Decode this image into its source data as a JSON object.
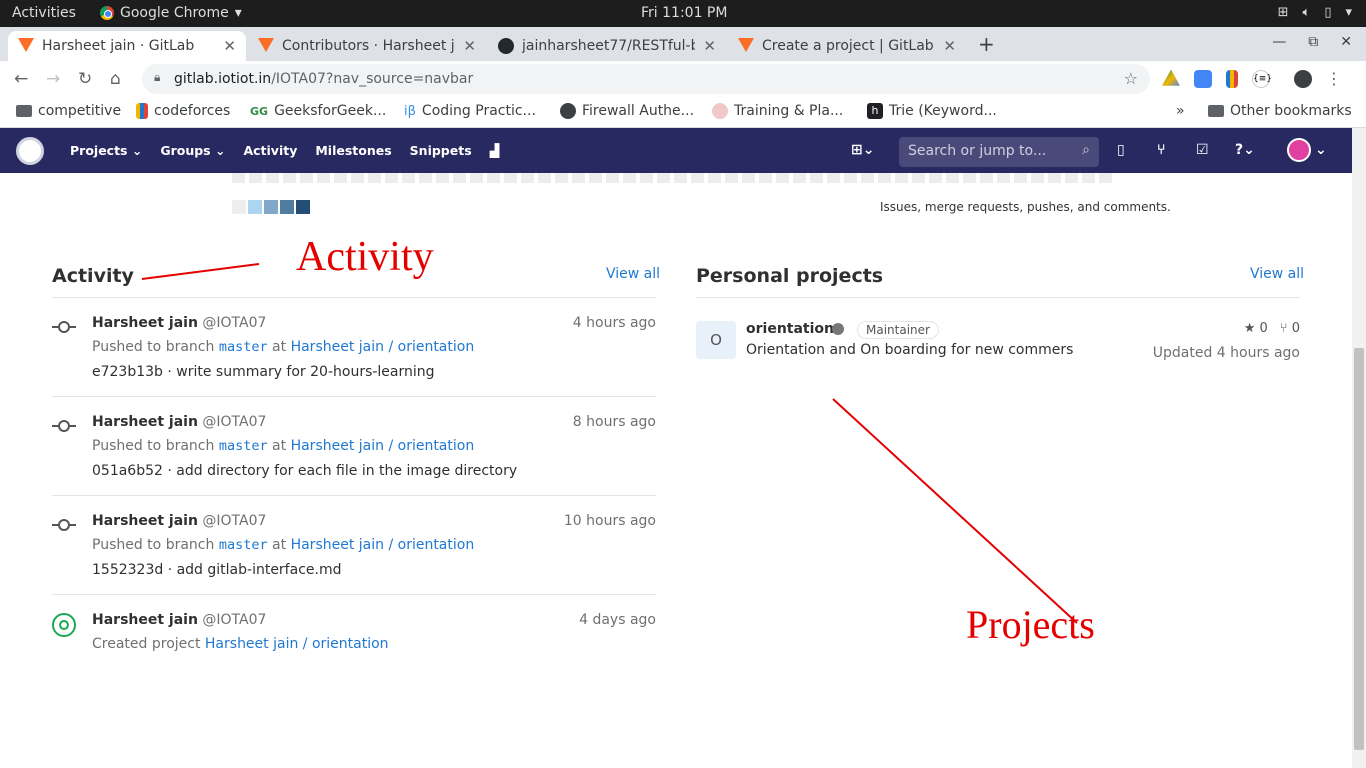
{
  "system_bar": {
    "activities": "Activities",
    "app_name": "Google Chrome",
    "clock": "Fri 11:01 PM"
  },
  "browser": {
    "tabs": [
      {
        "title": "Harsheet jain · GitLab",
        "active": true,
        "icon": "gitlab-icon"
      },
      {
        "title": "Contributors · Harsheet ja",
        "active": false,
        "icon": "gitlab-icon"
      },
      {
        "title": "jainharsheet77/RESTful-b",
        "active": false,
        "icon": "github-icon"
      },
      {
        "title": "Create a project | GitLab",
        "active": false,
        "icon": "gitlab-icon"
      }
    ],
    "new_tab": "+",
    "url_host": "gitlab.iotiot.in",
    "url_path": "/IOTA07?nav_source=navbar",
    "bookmarks": [
      {
        "label": "competitive",
        "icon": "folder-icon"
      },
      {
        "label": "codeforces",
        "icon": "codeforces-icon"
      },
      {
        "label": "GeeksforGeek...",
        "icon": "gfg-icon"
      },
      {
        "label": "Coding Practic...",
        "icon": "interviewbit-icon"
      },
      {
        "label": "Firewall Authe...",
        "icon": "globe-icon"
      },
      {
        "label": "Training & Pla...",
        "icon": "seal-icon"
      },
      {
        "label": "Trie (Keyword...",
        "icon": "h-icon"
      }
    ],
    "bookmarks_more": "»",
    "other_bookmarks": "Other bookmarks"
  },
  "gitlab_nav": {
    "items": [
      "Projects ⌄",
      "Groups ⌄",
      "Activity",
      "Milestones",
      "Snippets"
    ],
    "search_placeholder": "Search or jump to..."
  },
  "calendar": {
    "caption": "Issues, merge requests, pushes, and comments.",
    "legend_colors": [
      "#ededed",
      "#acd5f2",
      "#7fa8c9",
      "#527ba0",
      "#254e77"
    ]
  },
  "activity": {
    "title": "Activity",
    "view_all": "View all",
    "events": [
      {
        "author": "Harsheet jain",
        "handle": "@IOTA07",
        "time": "4 hours ago",
        "action": "Pushed to branch",
        "branch": "master",
        "at": "at",
        "project": "Harsheet jain / orientation",
        "commit": "e723b13b · write summary for 20-hours-learning",
        "type": "push"
      },
      {
        "author": "Harsheet jain",
        "handle": "@IOTA07",
        "time": "8 hours ago",
        "action": "Pushed to branch",
        "branch": "master",
        "at": "at",
        "project": "Harsheet jain / orientation",
        "commit": "051a6b52 · add directory for each file in the image directory",
        "type": "push"
      },
      {
        "author": "Harsheet jain",
        "handle": "@IOTA07",
        "time": "10 hours ago",
        "action": "Pushed to branch",
        "branch": "master",
        "at": "at",
        "project": "Harsheet jain / orientation",
        "commit": "1552323d · add gitlab-interface.md",
        "type": "push"
      },
      {
        "author": "Harsheet jain",
        "handle": "@IOTA07",
        "time": "4 days ago",
        "action": "Created project",
        "project": "Harsheet jain / orientation",
        "type": "created"
      }
    ]
  },
  "personal_projects": {
    "title": "Personal projects",
    "view_all": "View all",
    "project": {
      "avatar_letter": "O",
      "name": "orientation",
      "role": "Maintainer",
      "description": "Orientation and On boarding for new commers",
      "stars": "0",
      "forks": "0",
      "updated": "Updated 4 hours ago"
    }
  },
  "annotations": {
    "activity_label": "Activity",
    "projects_label": "Projects",
    "color": "#e50000"
  }
}
